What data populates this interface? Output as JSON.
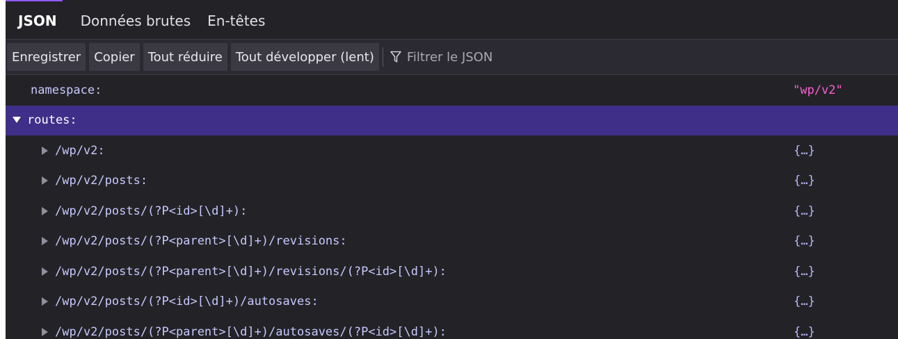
{
  "tabs": [
    {
      "label": "JSON",
      "active": true
    },
    {
      "label": "Données brutes",
      "active": false
    },
    {
      "label": "En-têtes",
      "active": false
    }
  ],
  "toolbar": {
    "save": "Enregistrer",
    "copy": "Copier",
    "collapse_all": "Tout réduire",
    "expand_all": "Tout développer (lent)",
    "filter_placeholder": "Filtrer le JSON"
  },
  "tree": {
    "namespace": {
      "key": "namespace:",
      "value": "\"wp/v2\""
    },
    "routes": {
      "key": "routes:",
      "children": [
        {
          "key": "/wp/v2:",
          "value": "{…}"
        },
        {
          "key": "/wp/v2/posts:",
          "value": "{…}"
        },
        {
          "key": "/wp/v2/posts/(?P<id>[\\d]+):",
          "value": "{…}"
        },
        {
          "key": "/wp/v2/posts/(?P<parent>[\\d]+)/revisions:",
          "value": "{…}"
        },
        {
          "key": "/wp/v2/posts/(?P<parent>[\\d]+)/revisions/(?P<id>[\\d]+):",
          "value": "{…}"
        },
        {
          "key": "/wp/v2/posts/(?P<id>[\\d]+)/autosaves:",
          "value": "{…}"
        },
        {
          "key": "/wp/v2/posts/(?P<parent>[\\d]+)/autosaves/(?P<id>[\\d]+):",
          "value": "{…}"
        }
      ]
    }
  },
  "colors": {
    "accent": "#9059ff",
    "selected_row": "#3f2f89",
    "string_value": "#ff5ed4",
    "key": "#c8c8ff"
  }
}
